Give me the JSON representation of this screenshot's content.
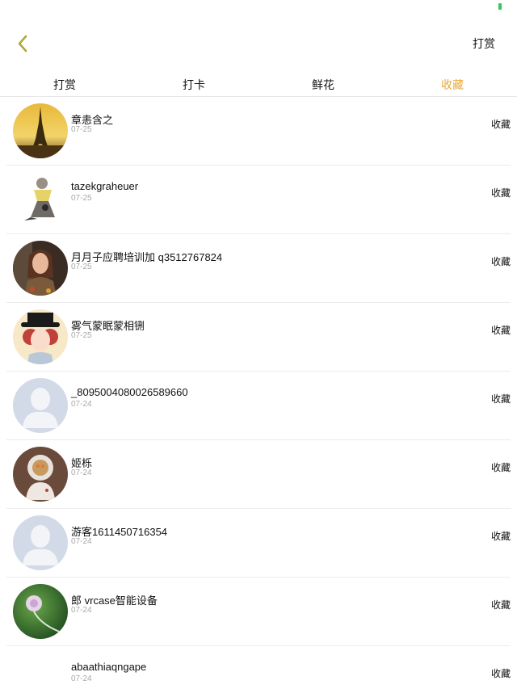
{
  "nav": {
    "title_right": "打赏"
  },
  "tabs": [
    {
      "label": "打赏"
    },
    {
      "label": "打卡"
    },
    {
      "label": "鲜花"
    },
    {
      "label": "收藏"
    }
  ],
  "colors": {
    "active_tab": "#e9a93a",
    "battery": "#34c759"
  },
  "items": [
    {
      "name": "章恚含之",
      "date": "07-25",
      "action": "收藏",
      "avatar": "eiffel-photo"
    },
    {
      "name": "tazekgraheuer",
      "date": "07-25",
      "action": "收藏",
      "avatar": "figurine-photo"
    },
    {
      "name": "月月子应聘培训加 q3512767824",
      "date": "07-25",
      "action": "收藏",
      "avatar": "woman-photo"
    },
    {
      "name": "雾气蒙眠蒙相铏",
      "date": "07-25",
      "action": "收藏",
      "avatar": "hat-girl-illustration"
    },
    {
      "name": "_8095004080026589660",
      "date": "07-24",
      "action": "收藏",
      "avatar": "default-avatar"
    },
    {
      "name": "姬栎",
      "date": "07-24",
      "action": "收藏",
      "avatar": "astronaut-photo"
    },
    {
      "name": "游客1611450716354",
      "date": "07-24",
      "action": "收藏",
      "avatar": "default-avatar"
    },
    {
      "name": "郎 vrcase智能设备",
      "date": "07-24",
      "action": "收藏",
      "avatar": "flower-photo"
    },
    {
      "name": "abaathiaqngape",
      "date": "07-24",
      "action": "收藏",
      "avatar": "blank"
    }
  ]
}
